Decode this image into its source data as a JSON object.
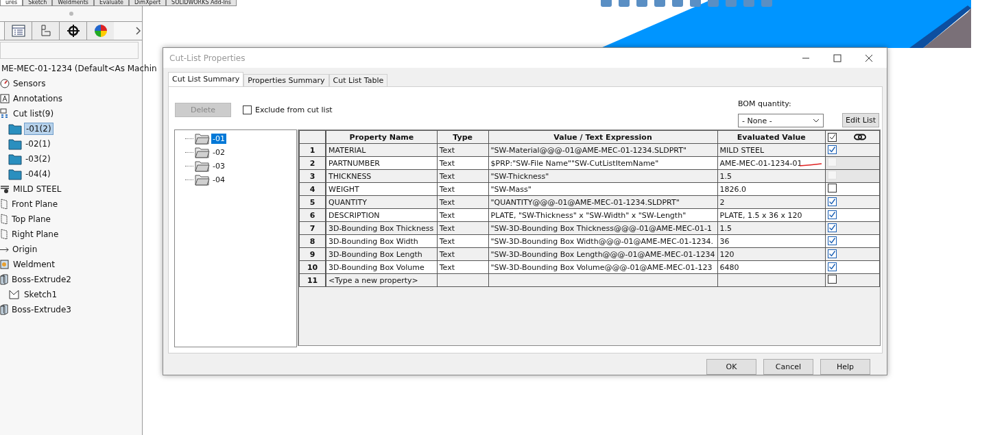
{
  "command_tabs": [
    {
      "label": "ures",
      "selected": true
    },
    {
      "label": "Sketch",
      "selected": false
    },
    {
      "label": "Weldments",
      "selected": false
    },
    {
      "label": "Evaluate",
      "selected": false
    },
    {
      "label": "DimXpert",
      "selected": false
    },
    {
      "label": "SOLIDWORKS Add-Ins",
      "selected": false
    }
  ],
  "feature_tree": {
    "root": "ME-MEC-01-1234  (Default<As Machin",
    "items": [
      {
        "label": "Sensors",
        "kind": "sensor",
        "selected": false
      },
      {
        "label": "Annotations",
        "kind": "annotation",
        "selected": false
      },
      {
        "label": "Cut list(9)",
        "kind": "cutlist",
        "selected": false,
        "children": [
          {
            "label": "-01(2)",
            "kind": "folder",
            "selected": true
          },
          {
            "label": "-02(1)",
            "kind": "folder",
            "selected": false
          },
          {
            "label": "-03(2)",
            "kind": "folder",
            "selected": false
          },
          {
            "label": "-04(4)",
            "kind": "folder",
            "selected": false
          }
        ]
      },
      {
        "label": "MILD STEEL",
        "kind": "material",
        "selected": false
      },
      {
        "label": "Front Plane",
        "kind": "plane",
        "selected": false
      },
      {
        "label": "Top Plane",
        "kind": "plane",
        "selected": false
      },
      {
        "label": "Right Plane",
        "kind": "plane",
        "selected": false
      },
      {
        "label": "Origin",
        "kind": "origin",
        "selected": false
      },
      {
        "label": "Weldment",
        "kind": "weldment",
        "selected": false
      },
      {
        "label": "Boss-Extrude2",
        "kind": "extrude",
        "selected": false,
        "children": [
          {
            "label": "Sketch1",
            "kind": "sketch",
            "selected": false
          }
        ]
      },
      {
        "label": "Boss-Extrude3",
        "kind": "extrude",
        "selected": false
      }
    ]
  },
  "dialog": {
    "title": "Cut-List Properties",
    "tabs": [
      {
        "label": "Cut List Summary",
        "selected": true
      },
      {
        "label": "Properties Summary",
        "selected": false
      },
      {
        "label": "Cut List Table",
        "selected": false
      }
    ],
    "delete_button": {
      "label": "Delete",
      "disabled": true
    },
    "exclude": {
      "label": "Exclude from cut list",
      "checked": false
    },
    "bom_quantity": {
      "label": "BOM quantity:",
      "value": "- None -"
    },
    "edit_list_button": "Edit List",
    "folders": [
      {
        "label": "-01",
        "selected": true
      },
      {
        "label": "-02",
        "selected": false
      },
      {
        "label": "-03",
        "selected": false
      },
      {
        "label": "-04",
        "selected": false
      }
    ],
    "table": {
      "columns": [
        "Property Name",
        "Type",
        "Value / Text Expression",
        "Evaluated Value"
      ],
      "rows": [
        {
          "index": "1",
          "name": "MATERIAL",
          "type": "Text",
          "value": "\"SW-Material@@@-01@AME-MEC-01-1234.SLDPRT\"",
          "evaluated": "MILD STEEL",
          "checked": true,
          "disabled": false
        },
        {
          "index": "2",
          "name": "PARTNUMBER",
          "type": "Text",
          "value": "$PRP:\"SW-File Name\"\"SW-CutListItemName\"",
          "evaluated": "AME-MEC-01-1234-01",
          "checked": false,
          "disabled": true
        },
        {
          "index": "3",
          "name": "THICKNESS",
          "type": "Text",
          "value": "\"SW-Thickness\"",
          "evaluated": "1.5",
          "checked": false,
          "disabled": true
        },
        {
          "index": "4",
          "name": "WEIGHT",
          "type": "Text",
          "value": "\"SW-Mass\"",
          "evaluated": "1826.0",
          "checked": false,
          "disabled": false
        },
        {
          "index": "5",
          "name": "QUANTITY",
          "type": "Text",
          "value": "\"QUANTITY@@@-01@AME-MEC-01-1234.SLDPRT\"",
          "evaluated": "2",
          "checked": true,
          "disabled": false
        },
        {
          "index": "6",
          "name": "DESCRIPTION",
          "type": "Text",
          "value": "PLATE, \"SW-Thickness\" x \"SW-Width\" x \"SW-Length\"",
          "evaluated": "PLATE, 1.5 x 36 x 120",
          "checked": true,
          "disabled": false
        },
        {
          "index": "7",
          "name": "3D-Bounding Box Thickness",
          "type": "Text",
          "value": "\"SW-3D-Bounding Box Thickness@@@-01@AME-MEC-01-1",
          "evaluated": "1.5",
          "checked": true,
          "disabled": false
        },
        {
          "index": "8",
          "name": "3D-Bounding Box Width",
          "type": "Text",
          "value": "\"SW-3D-Bounding Box Width@@@-01@AME-MEC-01-1234.",
          "evaluated": "36",
          "checked": true,
          "disabled": false
        },
        {
          "index": "9",
          "name": "3D-Bounding Box Length",
          "type": "Text",
          "value": "\"SW-3D-Bounding Box Length@@@-01@AME-MEC-01-1234",
          "evaluated": "120",
          "checked": true,
          "disabled": false
        },
        {
          "index": "10",
          "name": "3D-Bounding Box Volume",
          "type": "Text",
          "value": "\"SW-3D-Bounding Box Volume@@@-01@AME-MEC-01-123",
          "evaluated": "6480",
          "checked": true,
          "disabled": false
        },
        {
          "index": "11",
          "name": "<Type a new property>",
          "type": "",
          "value": "",
          "evaluated": "",
          "checked": false,
          "disabled": false
        }
      ]
    },
    "buttons": [
      "OK",
      "Cancel",
      "Help"
    ]
  }
}
